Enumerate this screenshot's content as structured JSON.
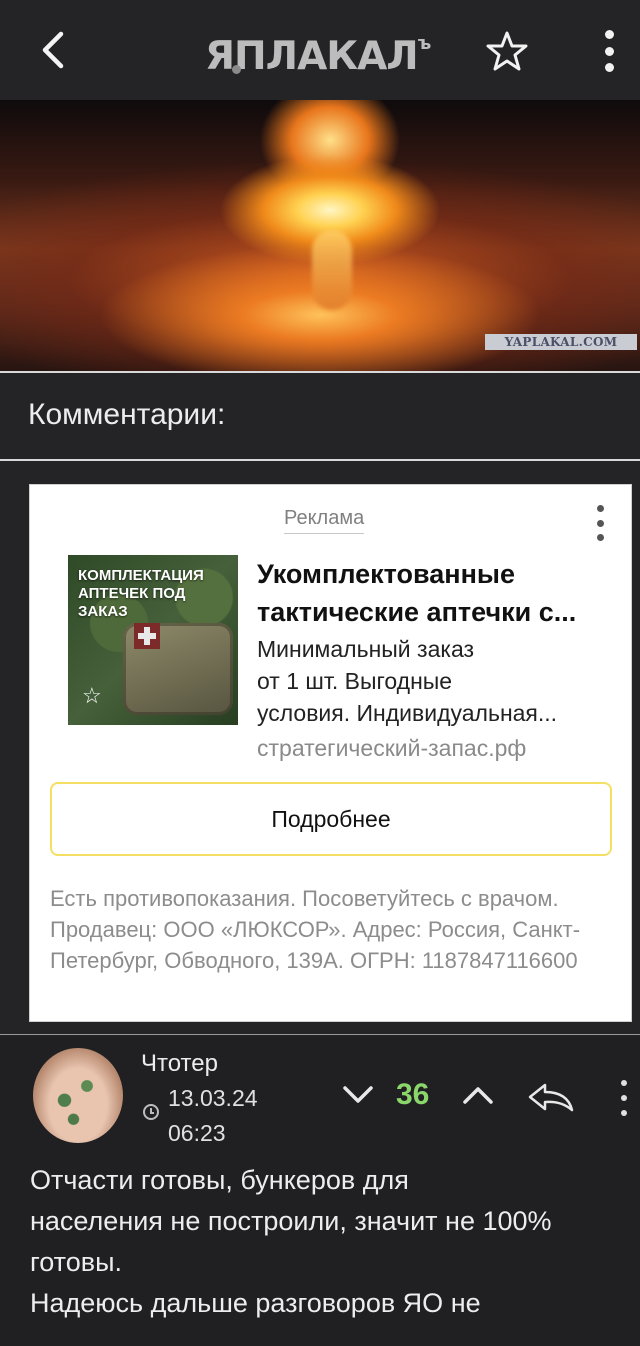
{
  "header": {
    "logo_text": "ЯПЛАКАЛ",
    "logo_suffix": "ъ",
    "back_icon": "chevron-left-icon",
    "favorite_icon": "star-outline-icon",
    "menu_icon": "kebab-menu-icon"
  },
  "hero": {
    "watermark": "YAPLAKAL.COM"
  },
  "comments_section": {
    "title": "Комментарии:"
  },
  "ad": {
    "label": "Реклама",
    "image_text": "КОМПЛЕКТАЦИЯ\nАПТЕЧЕК ПОД\nЗАКАЗ",
    "title_line1": "Укомплектованные",
    "title_line2": "тактические аптечки с...",
    "desc_line1": "Минимальный заказ",
    "desc_line2": "от 1 шт. Выгодные",
    "desc_line3": "условия. Индивидуальная...",
    "domain": "стратегический-запас.рф",
    "button_label": "Подробнее",
    "disclaimer": "Есть противопоказания. Посоветуйтесь с врачом. Продавец: ООО «ЛЮКСОР». Адрес: Россия, Санкт-Петербург, Обводного, 139А. ОГРН: 1187847116600"
  },
  "comment": {
    "author": "Чтотер",
    "date": "13.03.24",
    "time": "06:23",
    "score": "36",
    "text_line1": "Отчасти готовы, бункеров для",
    "text_line2": "населения не построили, значит не 100%",
    "text_line3": "готовы.",
    "text_line4": "Надеюсь дальше разговоров ЯО не"
  },
  "colors": {
    "background": "#242426",
    "score_green": "#8bd66a",
    "ad_button_border": "#f5df63"
  }
}
